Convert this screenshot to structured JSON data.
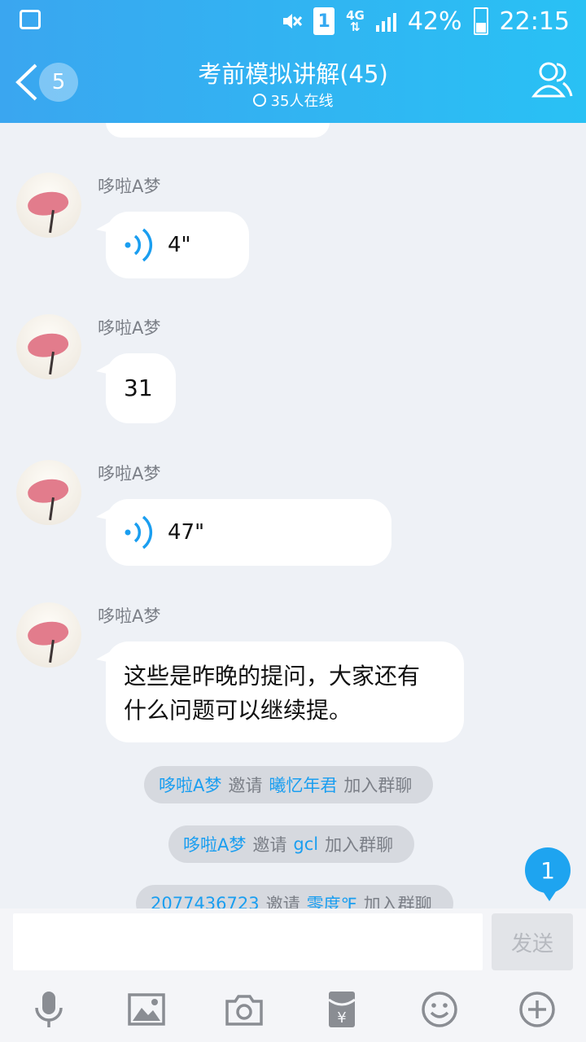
{
  "status": {
    "sim": "1",
    "network": "4G",
    "battery": "42%",
    "time": "22:15"
  },
  "header": {
    "unread_count": "5",
    "title": "考前模拟讲解(45)",
    "online": "35人在线"
  },
  "messages": [
    {
      "sender": "哆啦A梦",
      "type": "voice",
      "duration": "4\""
    },
    {
      "sender": "哆啦A梦",
      "type": "text",
      "text": "31"
    },
    {
      "sender": "哆啦A梦",
      "type": "voice",
      "duration": "47\""
    },
    {
      "sender": "哆啦A梦",
      "type": "text",
      "line1": "这些是昨晚的提问，大家还有",
      "line2": "什么问题可以继续提。"
    }
  ],
  "system": [
    {
      "inviter": "哆啦A梦",
      "verb": "邀请",
      "invitee": "曦忆年君",
      "suffix": "加入群聊"
    },
    {
      "inviter": "哆啦A梦",
      "verb": "邀请",
      "invitee": "gcl",
      "suffix": "加入群聊"
    },
    {
      "inviter": "2077436723",
      "verb": "邀请",
      "invitee": "零度℉",
      "suffix": "加入群聊"
    }
  ],
  "new_message_badge": "1",
  "input": {
    "value": "",
    "send_label": "发送"
  },
  "toolbar": [
    "microphone-icon",
    "image-icon",
    "camera-icon",
    "red-packet-icon",
    "emoji-icon",
    "plus-icon"
  ],
  "colors": {
    "header_gradient_start": "#3aa6f0",
    "header_gradient_end": "#29c1f4",
    "link": "#1a9ef0",
    "background": "#eef1f6"
  }
}
